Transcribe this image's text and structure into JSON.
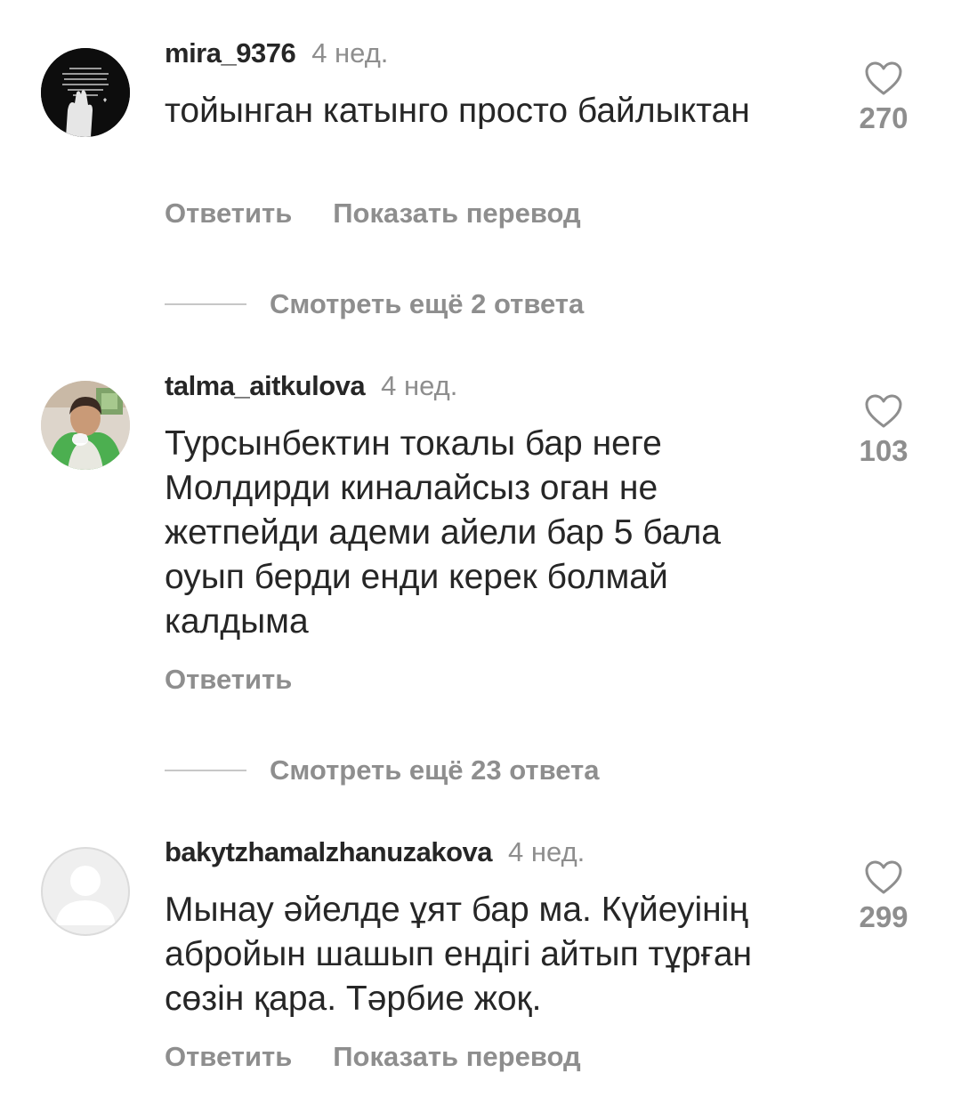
{
  "comments": [
    {
      "username": "mira_9376",
      "time": "4 нед.",
      "text": "тойынган катынго просто байлыктан",
      "likes": "270",
      "reply_label": "Ответить",
      "translate_label": "Показать перевод"
    },
    {
      "username": "talma_aitkulova",
      "time": "4 нед.",
      "text": "Турсынбектин токалы бар неге Молдирди киналайсыз оган не жетпейди адеми айели бар 5 бала оуып берди енди керек болмай калдыма",
      "likes": "103",
      "reply_label": "Ответить"
    },
    {
      "username": "bakytzhamalzhanuzakova",
      "time": "4 нед.",
      "text": "Мынау  әйелде ұят бар ма. Күйеуінің абройын шашып ендігі  айтып тұрған сөзін қара. Тәрбие  жоқ.",
      "likes": "299",
      "reply_label": "Ответить",
      "translate_label": "Показать перевод"
    }
  ],
  "view_replies": [
    {
      "label": "Смотреть ещё 2 ответа"
    },
    {
      "label": "Смотреть ещё 23 ответа"
    }
  ],
  "icons": {
    "like": "heart-outline-icon",
    "avatar_default": "default-user-avatar"
  },
  "colors": {
    "text_primary": "#262626",
    "text_secondary": "#8e8e8e",
    "divider": "#c7c7c7"
  }
}
